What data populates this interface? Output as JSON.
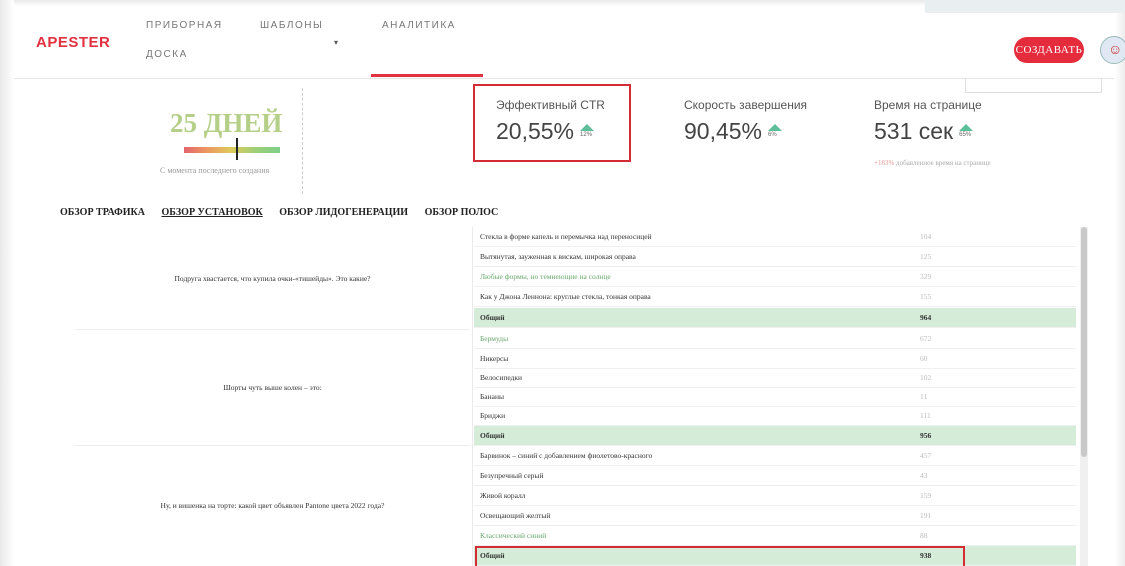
{
  "header": {
    "logo": "APESTER",
    "nav": [
      {
        "line1": "ПРИБОРНАЯ",
        "line2": "ДОСКА"
      },
      {
        "line1": "ШАБЛОНЫ",
        "caret": "▾"
      },
      {
        "line1": "АНАЛИТИКА"
      }
    ],
    "create_label": "СОЗДАВАТЬ",
    "accent": "#e2313f"
  },
  "stats": {
    "days": "25 ДНЕЙ",
    "since": "С момента последнего создания",
    "metrics": [
      {
        "label": "Эффективный CTR",
        "value": "20,55%",
        "change": "12%"
      },
      {
        "label": "Скорость завершения",
        "value": "90,45%",
        "change": "6%"
      },
      {
        "label": "Время на странице",
        "value": "531 сек",
        "change": "65%"
      }
    ],
    "added_pct": "+183%",
    "added_text": " добавленное время на странице"
  },
  "tabs": [
    "ОБЗОР ТРАФИКА",
    "ОБЗОР УСТАНОВОК",
    "ОБЗОР ЛИДОГЕНЕРАЦИИ",
    "ОБЗОР ПОЛОС"
  ],
  "table": {
    "questions": [
      "Подруга хвастается, что купила очки-«тишейды». Это какие?",
      "Шорты чуть выше колен – это:",
      "Ну, и вишенка на торте: какой цвет объявлен Pantone цвета 2022 года?"
    ],
    "rows": [
      {
        "answer": "Стекла в форме капель и перемычка над переносицей",
        "count": "104"
      },
      {
        "answer": "Вытянутая, зауженная к вискам, широкая оправа",
        "count": "125"
      },
      {
        "answer": "Любые формы, но темнеющие на солнце",
        "count": "329"
      },
      {
        "answer": "Как у Джона Леннона: круглые стекла, тонкая оправа",
        "count": "155"
      },
      {
        "answer": "Общий",
        "count": "964"
      },
      {
        "answer": "Бермуды",
        "count": "672"
      },
      {
        "answer": "Никерсы",
        "count": "60"
      },
      {
        "answer": "Велосипедки",
        "count": "102"
      },
      {
        "answer": "Бананы",
        "count": "11"
      },
      {
        "answer": "Бриджи",
        "count": "111"
      },
      {
        "answer": "Общий",
        "count": "956"
      },
      {
        "answer": "Барвинок – синий с добавлением фиолетово-красного",
        "count": "457"
      },
      {
        "answer": "Безупречный серый",
        "count": "43"
      },
      {
        "answer": "Живой коралл",
        "count": "159"
      },
      {
        "answer": "Освещающий желтый",
        "count": "191"
      },
      {
        "answer": "Классический синий",
        "count": "88"
      },
      {
        "answer": "Общий",
        "count": "938"
      }
    ]
  }
}
